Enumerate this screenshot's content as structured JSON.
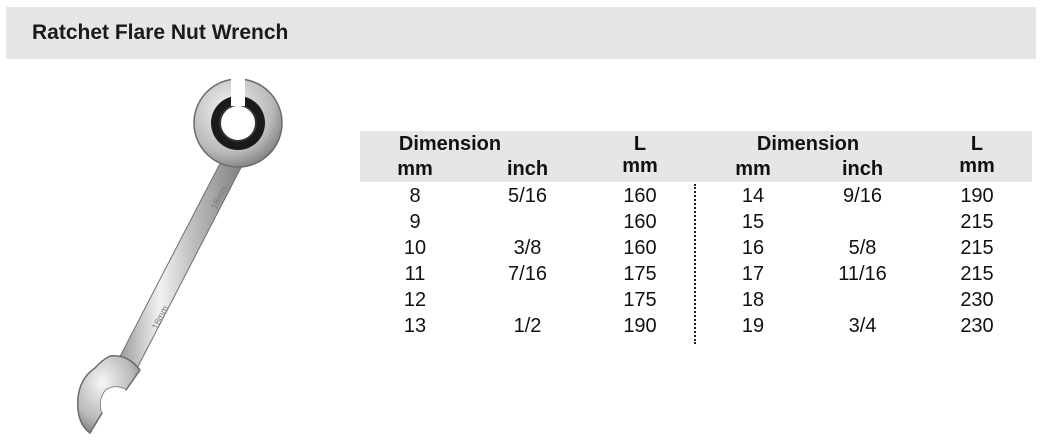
{
  "title": "Ratchet Flare Nut Wrench",
  "table": {
    "header": {
      "left_group": "Dimension",
      "left_mm": "mm",
      "left_inch": "inch",
      "left_L": "L",
      "left_L_unit": "mm",
      "right_group": "Dimension",
      "right_mm": "mm",
      "right_inch": "inch",
      "right_L": "L",
      "right_L_unit": "mm"
    },
    "rows": [
      {
        "mm": "8",
        "inch": "5/16",
        "L": "160",
        "mm2": "14",
        "inch2": "9/16",
        "L2": "190"
      },
      {
        "mm": "9",
        "inch": "",
        "L": "160",
        "mm2": "15",
        "inch2": "",
        "L2": "215"
      },
      {
        "mm": "10",
        "inch": "3/8",
        "L": "160",
        "mm2": "16",
        "inch2": "5/8",
        "L2": "215"
      },
      {
        "mm": "11",
        "inch": "7/16",
        "L": "175",
        "mm2": "17",
        "inch2": "11/16",
        "L2": "215"
      },
      {
        "mm": "12",
        "inch": "",
        "L": "175",
        "mm2": "18",
        "inch2": "",
        "L2": "230"
      },
      {
        "mm": "13",
        "inch": "1/2",
        "L": "190",
        "mm2": "19",
        "inch2": "3/4",
        "L2": "230"
      }
    ]
  },
  "image": {
    "engraving_top": "18mm",
    "engraving_bottom": "18mm"
  }
}
